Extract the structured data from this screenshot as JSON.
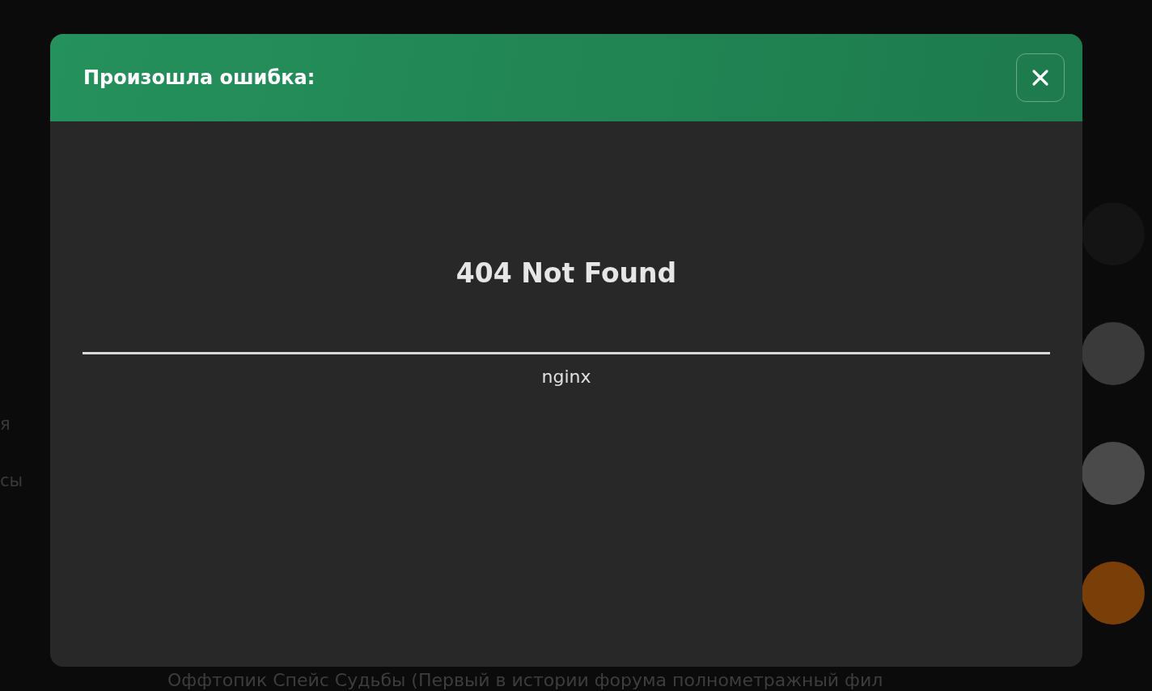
{
  "background": {
    "sidebar_fragments": [
      "я",
      "сы"
    ],
    "topic_title": "Оффтопик Спейс Судьбы (Первый в истории форума полнометражный фил"
  },
  "dialog": {
    "title": "Произошла ошибка:",
    "heading": "404 Not Found",
    "server": "nginx"
  }
}
